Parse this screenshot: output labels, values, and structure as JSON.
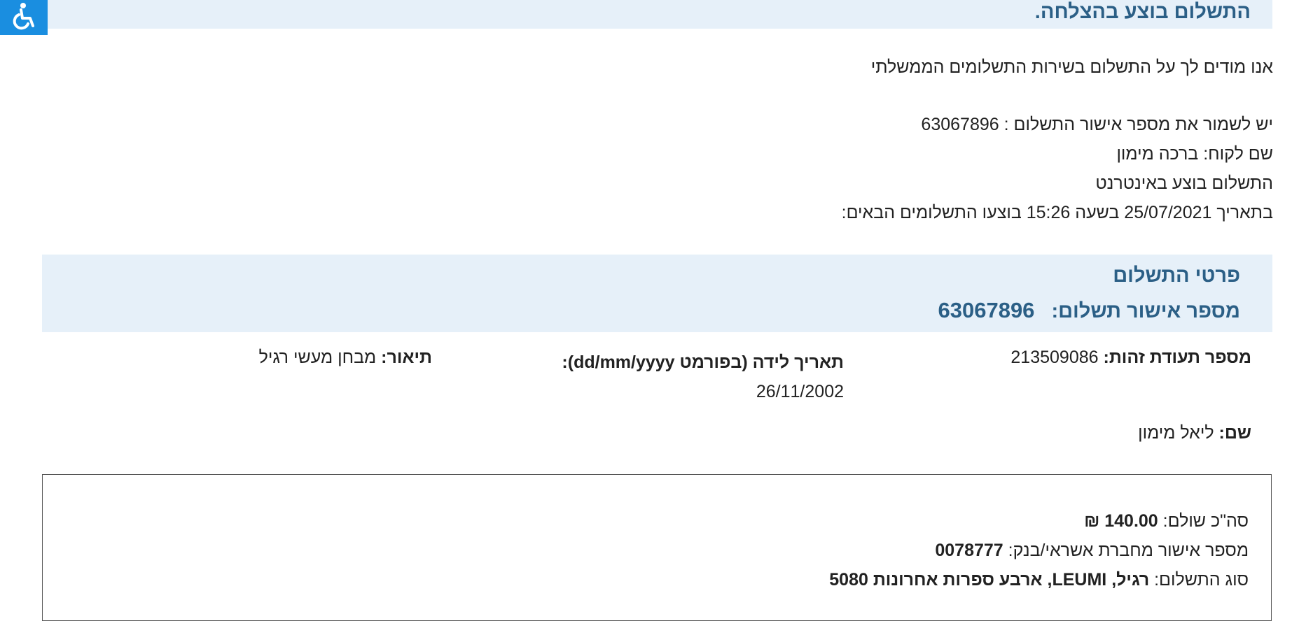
{
  "accessibility": {
    "icon": "wheelchair-icon"
  },
  "banner": {
    "title": "התשלום בוצע בהצלחה."
  },
  "intro": {
    "thanks": "אנו מודים לך על התשלום בשירות התשלומים הממשלתי",
    "save_approval": "יש לשמור את מספר אישור התשלום : 63067896",
    "customer_name": "שם לקוח: ברכה מימון",
    "channel": "התשלום בוצע באינטרנט",
    "date_time": "בתאריך 25/07/2021 בשעה 15:26 בוצעו התשלומים הבאים:"
  },
  "details": {
    "title": "פרטי התשלום",
    "approval_label": "מספר אישור תשלום:",
    "approval_number": "63067896"
  },
  "fields": {
    "id_label": "מספר תעודת זהות:",
    "id_value": "213509086",
    "dob_label": "תאריך לידה (בפורמט dd/mm/yyyy):",
    "dob_value": "26/11/2002",
    "desc_label": "תיאור:",
    "desc_value": "מבחן מעשי רגיל",
    "name_label": "שם:",
    "name_value": "ליאל מימון"
  },
  "summary": {
    "total_label": "סה\"כ שולם:",
    "total_value": "140.00 ₪",
    "bank_label": "מספר אישור מחברת אשראי/בנק:",
    "bank_value": "0078777",
    "type_label": "סוג התשלום:",
    "type_value": "רגיל, LEUMI, ארבע ספרות אחרונות 5080"
  }
}
